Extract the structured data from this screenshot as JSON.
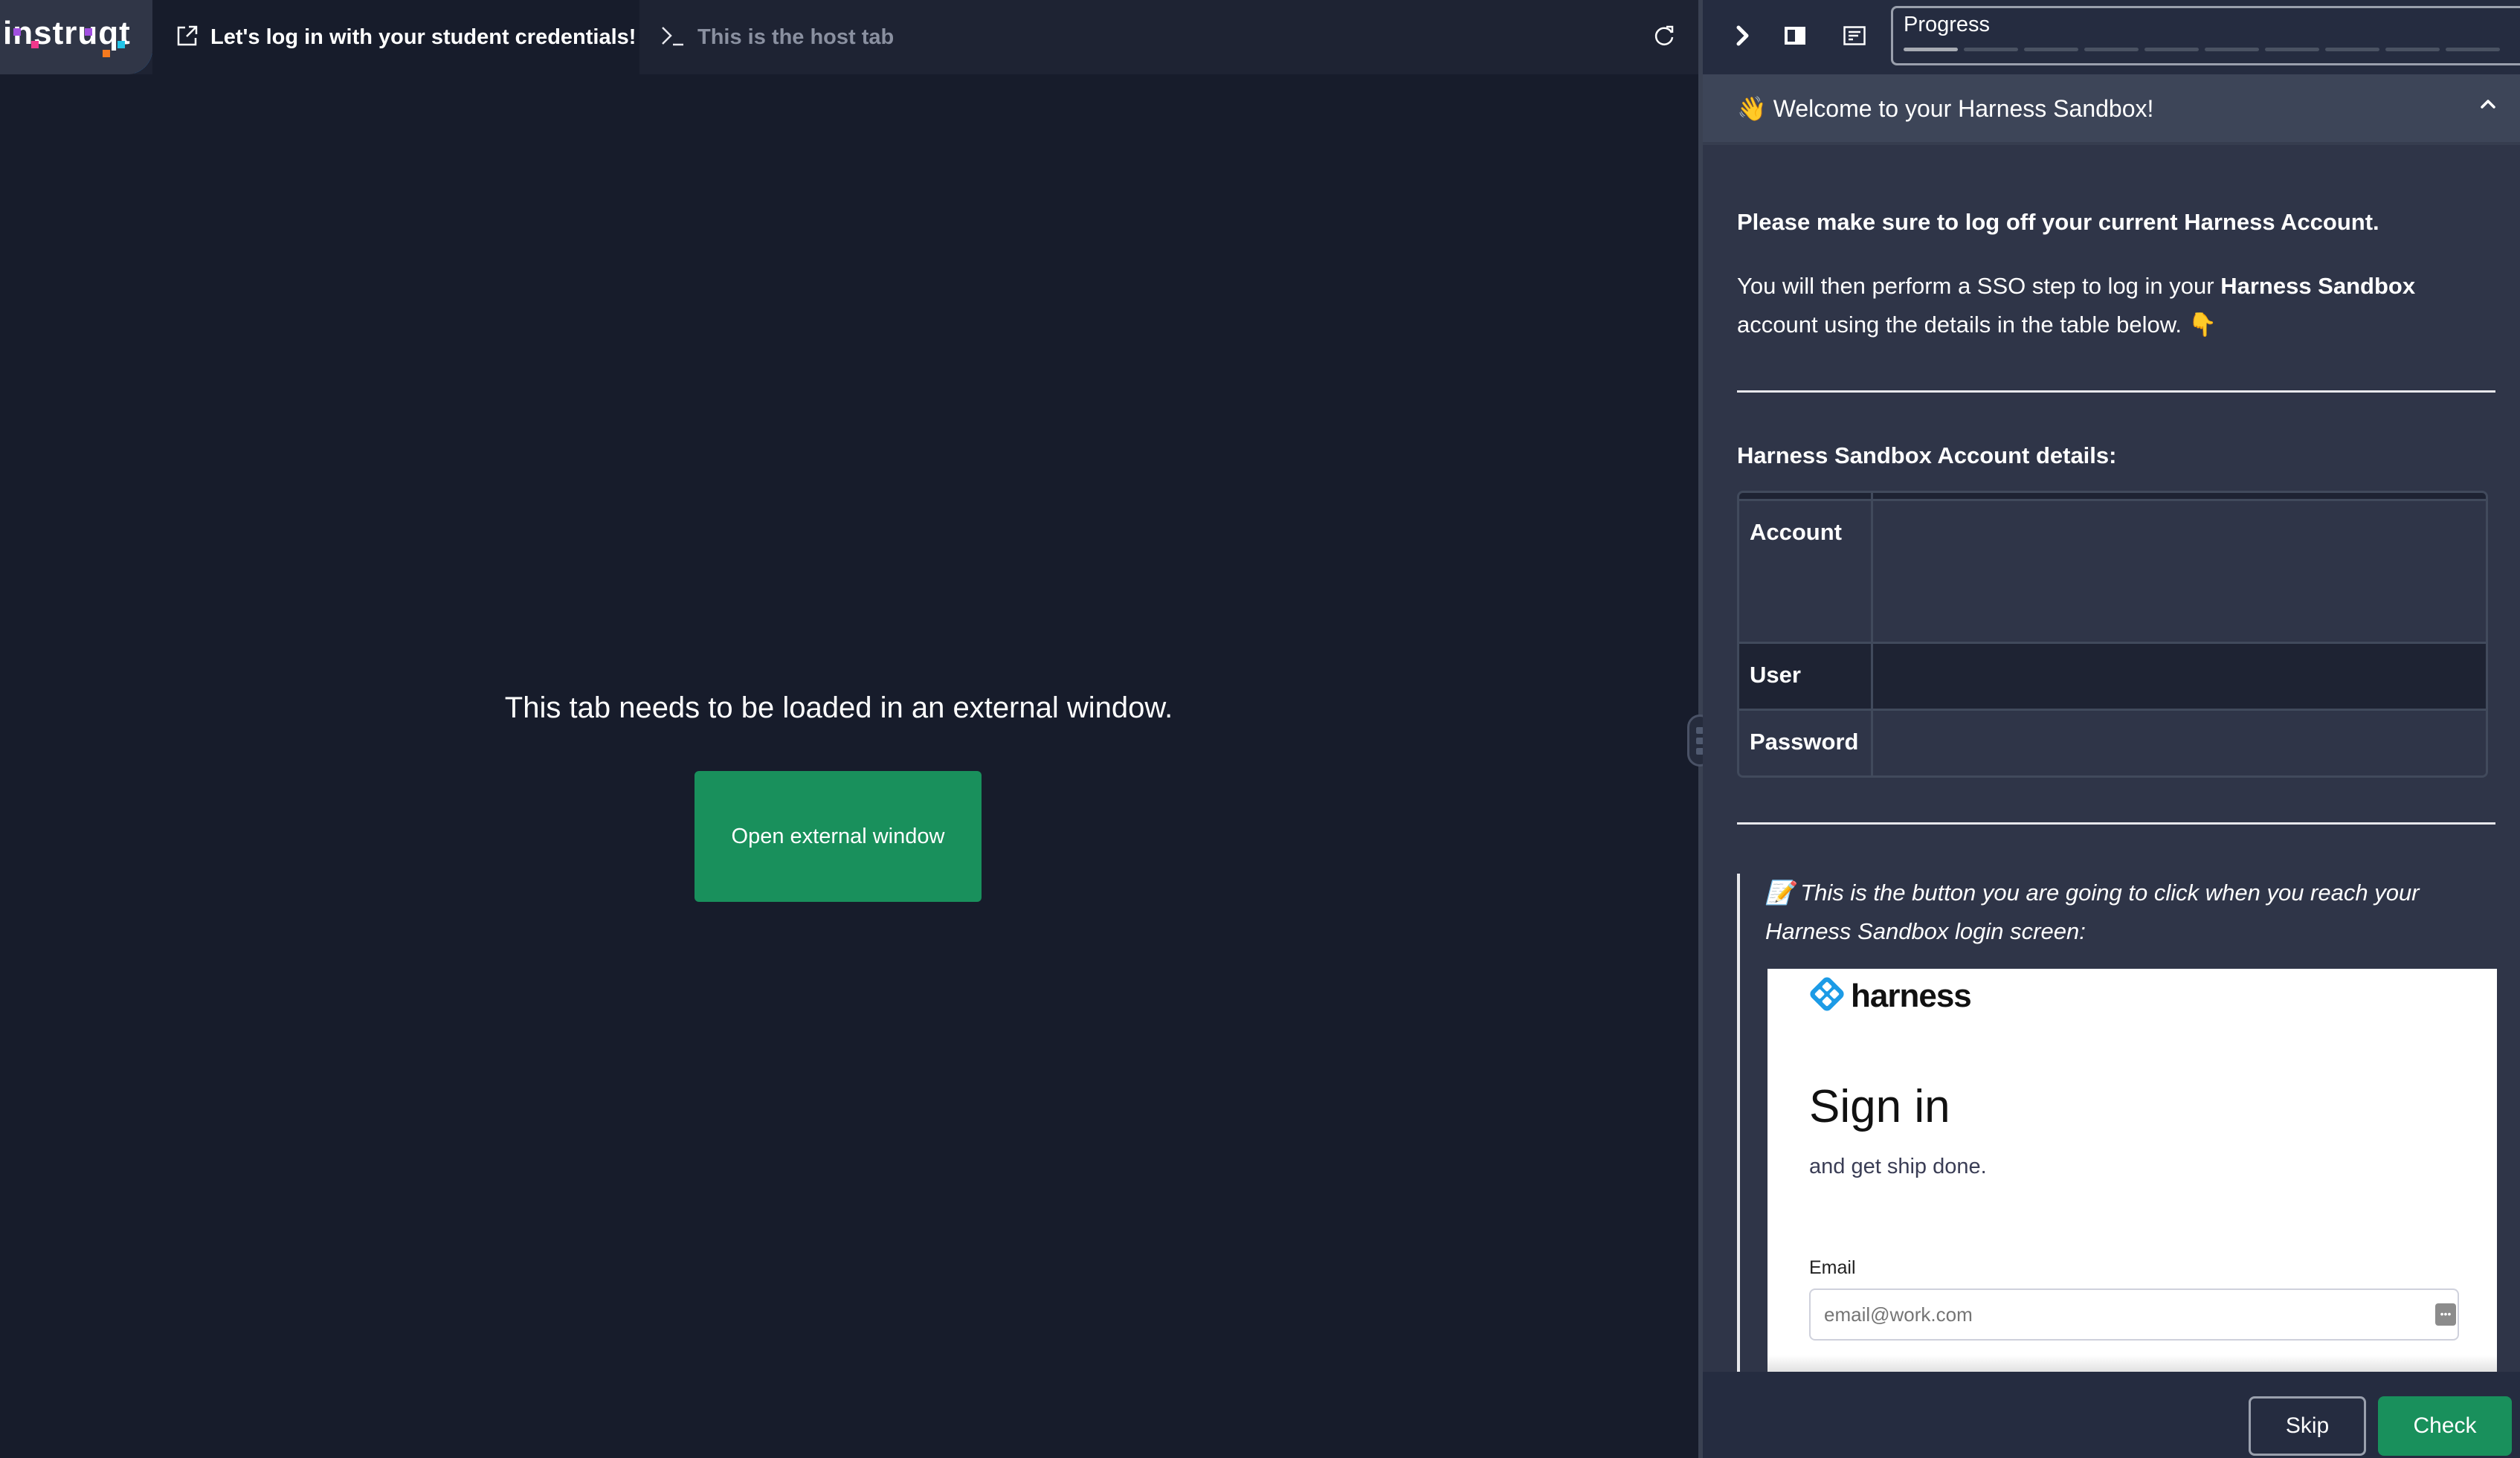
{
  "app": {
    "logo_text": "instruqt",
    "logo_dot_colors": [
      "#a14fe0",
      "#f0388c",
      "#f57a1f",
      "#22c4e8"
    ],
    "accent_color": "#1a86f0"
  },
  "tabs": [
    {
      "label": "Let's log in with your student credentials!",
      "icon": "external-link-icon",
      "active": true
    },
    {
      "label": "This is the host tab",
      "icon": "terminal-icon",
      "active": false
    }
  ],
  "left_pane": {
    "message": "This tab needs to be loaded in an external window.",
    "open_button_label": "Open external window",
    "button_color": "#19905c"
  },
  "right_header": {
    "icons": [
      "chevron-right-icon",
      "panel-layout-icon",
      "notes-icon"
    ],
    "progress_label": "Progress",
    "progress_segments_visible": 10,
    "progress_segments_completed": 1
  },
  "assignment": {
    "accordion_title": "👋 Welcome to your Harness Sandbox!",
    "expanded": true,
    "bold_paragraph": "Please make sure to log off your current Harness Account.",
    "paragraph_part1": "You will then perform a SSO step to log in your ",
    "paragraph_bold": "Harness Sandbox",
    "paragraph_part2": " account using the details in the table below. 👇",
    "details_heading": "Harness Sandbox Account details:",
    "table": {
      "rows": [
        {
          "label": "Account",
          "value": ""
        },
        {
          "label": "User",
          "value": ""
        },
        {
          "label": "Password",
          "value": ""
        }
      ]
    },
    "blockquote_text": "📝 This is the button you are going to click when you reach your Harness Sandbox login screen:",
    "embedded_screenshot": {
      "brand": "harness",
      "title": "Sign in",
      "subtitle": "and get ship done.",
      "email_label": "Email",
      "email_placeholder": "email@work.com",
      "brand_color": "#1c9be6"
    }
  },
  "footer": {
    "skip_label": "Skip",
    "check_label": "Check"
  }
}
